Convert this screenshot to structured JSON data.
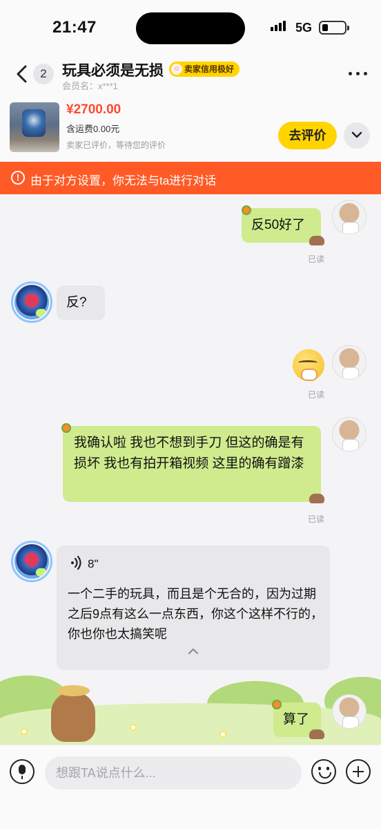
{
  "status_bar": {
    "time": "21:47",
    "network": "5G"
  },
  "header": {
    "unread_count": "2",
    "title": "玩具必须是无损",
    "credit_badge": "卖家信用极好",
    "member_name": "会员名：x***1"
  },
  "item": {
    "price": "¥2700.00",
    "shipping": "含运费0.00元",
    "status": "卖家已评价，等待您的评价",
    "review_button": "去评价"
  },
  "warning": {
    "text": "由于对方设置，你无法与ta进行对话"
  },
  "messages": [
    {
      "from": "me",
      "text": "反50好了",
      "read": "已读"
    },
    {
      "from": "them",
      "text": "反?"
    },
    {
      "from": "me",
      "type": "sticker",
      "read": "已读"
    },
    {
      "from": "me",
      "text": "我确认啦 我也不想到手刀 但这的确是有损坏 我也有拍开箱视频 这里的确有蹭漆",
      "read": "已读"
    },
    {
      "from": "them",
      "type": "voice",
      "duration": "8\"",
      "transcript": "一个二手的玩具，而且是个无合的，因为过期之后9点有这么一点东西，你这个这样不行的，你也你也太搞笑呢"
    },
    {
      "from": "me",
      "text": "算了"
    }
  ],
  "input": {
    "placeholder": "想跟TA说点什么..."
  },
  "icons": {
    "back": "chevron-left-icon",
    "more": "more-dots-icon",
    "expand": "chevron-down-icon",
    "warning": "alert-circle-icon",
    "voice": "voice-wave-icon",
    "mic": "microphone-icon",
    "emoji": "emoji-icon",
    "plus": "plus-icon"
  },
  "colors": {
    "accent_yellow": "#ffd400",
    "price_red": "#ff4a2f",
    "warning_orange": "#ff5a26",
    "my_bubble": "#cfeb8e"
  }
}
